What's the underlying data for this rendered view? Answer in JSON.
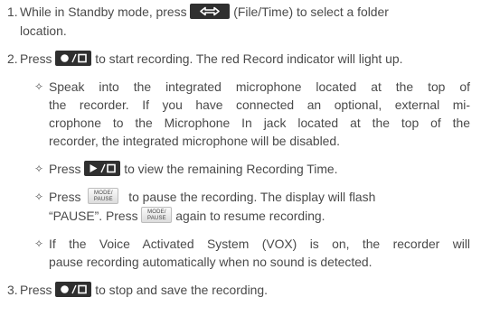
{
  "step1": {
    "number": "1.",
    "text_a": "While in Standby mode, press",
    "text_b": "(File/Time) to select a folder",
    "text_c": "location.",
    "key": "file-time-icon"
  },
  "step2": {
    "number": "2.",
    "text_a": "Press",
    "text_b": "to start recording. The red Record indicator will light up.",
    "key": "record-stop-icon",
    "bullets": {
      "b1": {
        "line1": "Speak into the integrated microphone located at the top of",
        "line2": "the recorder. If you have connected an optional, external mi-",
        "line3": "crophone to the Microphone In jack located at the top of the",
        "line4": "recorder, the integrated microphone will be disabled."
      },
      "b2": {
        "text_a": "Press",
        "text_b": "to view the remaining Recording Time.",
        "key": "play-stop-icon"
      },
      "b3": {
        "text_a": "Press",
        "text_b": "to pause the recording. The display will flash",
        "text_c": "“PAUSE”. Press",
        "text_d": "again to resume recording.",
        "key_top": "MODE/",
        "key_bottom": "PAUSE"
      },
      "b4": {
        "line1": "If the Voice Activated System (VOX) is on, the recorder will",
        "line2": "pause recording automatically when no sound is detected."
      }
    }
  },
  "step3": {
    "number": "3.",
    "text_a": "Press",
    "text_b": "to stop and save the recording.",
    "key": "record-stop-icon"
  },
  "bullet_glyph": "✧"
}
